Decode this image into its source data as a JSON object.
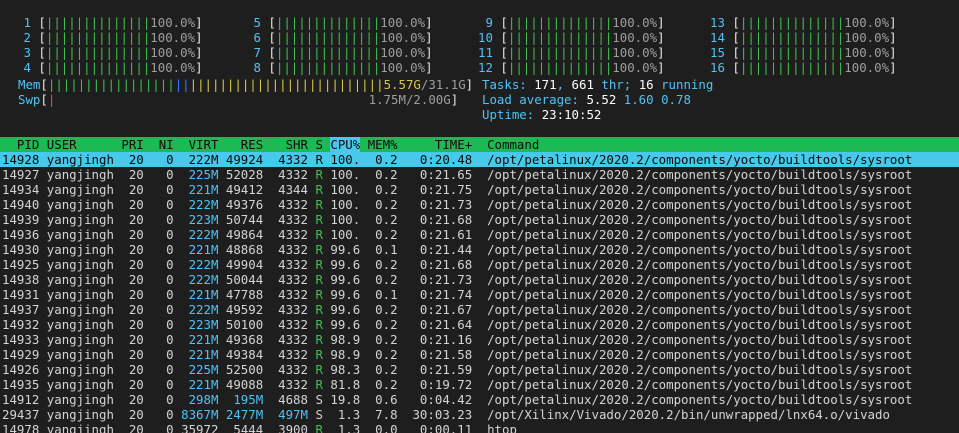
{
  "cpus": [
    {
      "id": "1",
      "pct": "100.0%"
    },
    {
      "id": "2",
      "pct": "100.0%"
    },
    {
      "id": "3",
      "pct": "100.0%"
    },
    {
      "id": "4",
      "pct": "100.0%"
    },
    {
      "id": "5",
      "pct": "100.0%"
    },
    {
      "id": "6",
      "pct": "100.0%"
    },
    {
      "id": "7",
      "pct": "100.0%"
    },
    {
      "id": "8",
      "pct": "100.0%"
    },
    {
      "id": "9",
      "pct": "100.0%"
    },
    {
      "id": "10",
      "pct": "100.0%"
    },
    {
      "id": "11",
      "pct": "100.0%"
    },
    {
      "id": "12",
      "pct": "100.0%"
    },
    {
      "id": "13",
      "pct": "100.0%"
    },
    {
      "id": "14",
      "pct": "100.0%"
    },
    {
      "id": "15",
      "pct": "100.0%"
    },
    {
      "id": "16",
      "pct": "100.0%"
    }
  ],
  "mem": {
    "label": "Mem",
    "used": "5.57G",
    "total": "/31.1G"
  },
  "swp": {
    "label": "Swp",
    "value": "1.75M/2.00G"
  },
  "tasks": {
    "label": "Tasks: ",
    "count": "171",
    "sep": ", ",
    "thr": "661",
    "thr_label": " thr; ",
    "running": "16",
    "running_label": " running"
  },
  "load": {
    "label": "Load average: ",
    "v1": "5.52",
    "v5": "1.60",
    "v15": "0.78"
  },
  "uptime": {
    "label": "Uptime: ",
    "value": "23:10:52"
  },
  "columns": {
    "pid": "PID",
    "user": "USER",
    "pri": "PRI",
    "ni": "NI",
    "virt": "VIRT",
    "res": "RES",
    "shr": "SHR",
    "s": "S",
    "cpu": "CPU%",
    "mem": "MEM%",
    "time": "TIME+",
    "command": "Command"
  },
  "processes": [
    {
      "pid": "14928",
      "user": "yangjingh",
      "pri": "20",
      "ni": "0",
      "virt": "222M",
      "res": "49924",
      "shr": "4332",
      "s": "R",
      "cpu": "100.",
      "mem": "0.2",
      "time": "0:20.48",
      "cmd": "/opt/petalinux/2020.2/components/yocto/buildtools/sysroot"
    },
    {
      "pid": "14927",
      "user": "yangjingh",
      "pri": "20",
      "ni": "0",
      "virt": "225M",
      "res": "52028",
      "shr": "4332",
      "s": "R",
      "cpu": "100.",
      "mem": "0.2",
      "time": "0:21.65",
      "cmd": "/opt/petalinux/2020.2/components/yocto/buildtools/sysroot"
    },
    {
      "pid": "14934",
      "user": "yangjingh",
      "pri": "20",
      "ni": "0",
      "virt": "221M",
      "res": "49412",
      "shr": "4344",
      "s": "R",
      "cpu": "100.",
      "mem": "0.2",
      "time": "0:21.75",
      "cmd": "/opt/petalinux/2020.2/components/yocto/buildtools/sysroot"
    },
    {
      "pid": "14940",
      "user": "yangjingh",
      "pri": "20",
      "ni": "0",
      "virt": "222M",
      "res": "49376",
      "shr": "4332",
      "s": "R",
      "cpu": "100.",
      "mem": "0.2",
      "time": "0:21.73",
      "cmd": "/opt/petalinux/2020.2/components/yocto/buildtools/sysroot"
    },
    {
      "pid": "14939",
      "user": "yangjingh",
      "pri": "20",
      "ni": "0",
      "virt": "223M",
      "res": "50744",
      "shr": "4332",
      "s": "R",
      "cpu": "100.",
      "mem": "0.2",
      "time": "0:21.68",
      "cmd": "/opt/petalinux/2020.2/components/yocto/buildtools/sysroot"
    },
    {
      "pid": "14936",
      "user": "yangjingh",
      "pri": "20",
      "ni": "0",
      "virt": "222M",
      "res": "49864",
      "shr": "4332",
      "s": "R",
      "cpu": "100.",
      "mem": "0.2",
      "time": "0:21.61",
      "cmd": "/opt/petalinux/2020.2/components/yocto/buildtools/sysroot"
    },
    {
      "pid": "14930",
      "user": "yangjingh",
      "pri": "20",
      "ni": "0",
      "virt": "221M",
      "res": "48868",
      "shr": "4332",
      "s": "R",
      "cpu": "99.6",
      "mem": "0.1",
      "time": "0:21.44",
      "cmd": "/opt/petalinux/2020.2/components/yocto/buildtools/sysroot"
    },
    {
      "pid": "14925",
      "user": "yangjingh",
      "pri": "20",
      "ni": "0",
      "virt": "222M",
      "res": "49904",
      "shr": "4332",
      "s": "R",
      "cpu": "99.6",
      "mem": "0.2",
      "time": "0:21.68",
      "cmd": "/opt/petalinux/2020.2/components/yocto/buildtools/sysroot"
    },
    {
      "pid": "14938",
      "user": "yangjingh",
      "pri": "20",
      "ni": "0",
      "virt": "222M",
      "res": "50044",
      "shr": "4332",
      "s": "R",
      "cpu": "99.6",
      "mem": "0.2",
      "time": "0:21.73",
      "cmd": "/opt/petalinux/2020.2/components/yocto/buildtools/sysroot"
    },
    {
      "pid": "14931",
      "user": "yangjingh",
      "pri": "20",
      "ni": "0",
      "virt": "221M",
      "res": "47788",
      "shr": "4332",
      "s": "R",
      "cpu": "99.6",
      "mem": "0.1",
      "time": "0:21.74",
      "cmd": "/opt/petalinux/2020.2/components/yocto/buildtools/sysroot"
    },
    {
      "pid": "14937",
      "user": "yangjingh",
      "pri": "20",
      "ni": "0",
      "virt": "222M",
      "res": "49592",
      "shr": "4332",
      "s": "R",
      "cpu": "99.6",
      "mem": "0.2",
      "time": "0:21.67",
      "cmd": "/opt/petalinux/2020.2/components/yocto/buildtools/sysroot"
    },
    {
      "pid": "14932",
      "user": "yangjingh",
      "pri": "20",
      "ni": "0",
      "virt": "223M",
      "res": "50100",
      "shr": "4332",
      "s": "R",
      "cpu": "99.6",
      "mem": "0.2",
      "time": "0:21.64",
      "cmd": "/opt/petalinux/2020.2/components/yocto/buildtools/sysroot"
    },
    {
      "pid": "14933",
      "user": "yangjingh",
      "pri": "20",
      "ni": "0",
      "virt": "221M",
      "res": "49368",
      "shr": "4332",
      "s": "R",
      "cpu": "98.9",
      "mem": "0.2",
      "time": "0:21.16",
      "cmd": "/opt/petalinux/2020.2/components/yocto/buildtools/sysroot"
    },
    {
      "pid": "14929",
      "user": "yangjingh",
      "pri": "20",
      "ni": "0",
      "virt": "221M",
      "res": "49384",
      "shr": "4332",
      "s": "R",
      "cpu": "98.9",
      "mem": "0.2",
      "time": "0:21.58",
      "cmd": "/opt/petalinux/2020.2/components/yocto/buildtools/sysroot"
    },
    {
      "pid": "14926",
      "user": "yangjingh",
      "pri": "20",
      "ni": "0",
      "virt": "225M",
      "res": "52500",
      "shr": "4332",
      "s": "R",
      "cpu": "98.3",
      "mem": "0.2",
      "time": "0:21.59",
      "cmd": "/opt/petalinux/2020.2/components/yocto/buildtools/sysroot"
    },
    {
      "pid": "14935",
      "user": "yangjingh",
      "pri": "20",
      "ni": "0",
      "virt": "221M",
      "res": "49088",
      "shr": "4332",
      "s": "R",
      "cpu": "81.8",
      "mem": "0.2",
      "time": "0:19.72",
      "cmd": "/opt/petalinux/2020.2/components/yocto/buildtools/sysroot"
    },
    {
      "pid": "14912",
      "user": "yangjingh",
      "pri": "20",
      "ni": "0",
      "virt": "298M",
      "res": "195M",
      "shr": "4688",
      "s": "S",
      "cpu": "19.8",
      "mem": "0.6",
      "time": "0:04.42",
      "cmd": "/opt/petalinux/2020.2/components/yocto/buildtools/sysroot"
    },
    {
      "pid": "29437",
      "user": "yangjingh",
      "pri": "20",
      "ni": "0",
      "virt": "8367M",
      "res": "2477M",
      "shr": "497M",
      "s": "S",
      "cpu": "1.3",
      "mem": "7.8",
      "time": "30:03.23",
      "cmd": "/opt/Xilinx/Vivado/2020.2/bin/unwrapped/lnx64.o/vivado"
    },
    {
      "pid": "14978",
      "user": "yangjingh",
      "pri": "20",
      "ni": "0",
      "virt": "35972",
      "res": "5444",
      "shr": "3900",
      "s": "R",
      "cpu": "1.3",
      "mem": "0.0",
      "time": "0:00.11",
      "cmd": "htop"
    }
  ],
  "colors": {
    "background": "#1e1e1e",
    "header_bg": "#1db954",
    "selected_bg": "#46c9ea",
    "bar": "#3fbf4f"
  }
}
